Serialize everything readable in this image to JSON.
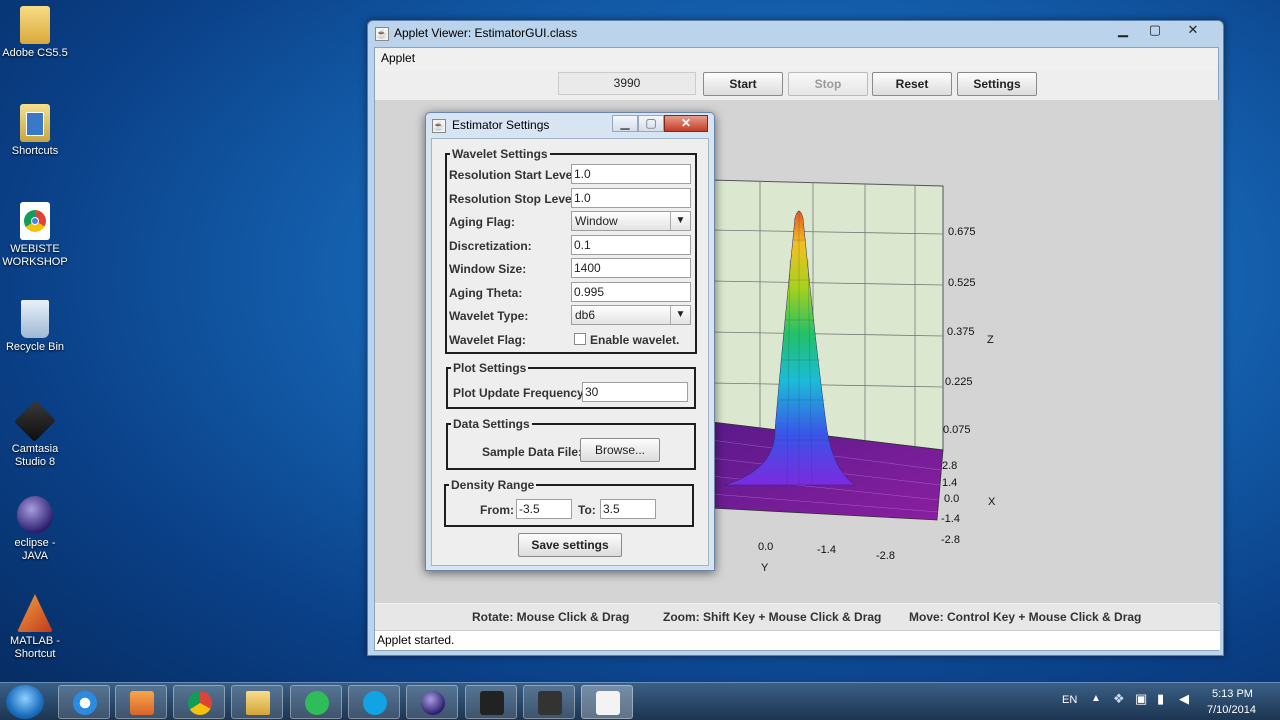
{
  "desktop": {
    "icons": [
      {
        "label": "Adobe CS5.5"
      },
      {
        "label": "Shortcuts"
      },
      {
        "label": "WEBISTE WORKSHOP"
      },
      {
        "label": "Recycle Bin"
      },
      {
        "label": "Camtasia Studio 8"
      },
      {
        "label": "eclipse - JAVA"
      },
      {
        "label": "MATLAB - Shortcut"
      }
    ]
  },
  "applet": {
    "title": "Applet Viewer: EstimatorGUI.class",
    "window_controls": {
      "minimize": "▁",
      "maximize": "▢",
      "close": "✕"
    },
    "menu": "Applet",
    "counter": "3990",
    "buttons": {
      "start": "Start",
      "stop": "Stop",
      "reset": "Reset",
      "settings": "Settings"
    },
    "stop_enabled": false,
    "plot": {
      "z_ticks": [
        "0.675",
        "0.525",
        "0.375",
        "0.225",
        "0.075"
      ],
      "x_ticks": [
        "2.8",
        "1.4",
        "0.0",
        "-1.4",
        "-2.8"
      ],
      "y_ticks": [
        "0.0",
        "-1.4",
        "-2.8"
      ],
      "z_label": "Z",
      "x_label": "X",
      "y_label": "Y"
    },
    "help": {
      "rotate": "Rotate: Mouse Click & Drag",
      "zoom": "Zoom: Shift Key + Mouse Click & Drag",
      "move": "Move: Control Key + Mouse Click & Drag"
    },
    "status": "Applet started."
  },
  "settings": {
    "title": "Estimator Settings",
    "wavelet": {
      "legend": "Wavelet Settings",
      "res_start_label": "Resolution Start Level:",
      "res_start": "1.0",
      "res_stop_label": "Resolution Stop Level:",
      "res_stop": "1.0",
      "aging_flag_label": "Aging Flag:",
      "aging_flag": "Window",
      "discretization_label": "Discretization:",
      "discretization": "0.1",
      "window_size_label": "Window Size:",
      "window_size": "1400",
      "aging_theta_label": "Aging Theta:",
      "aging_theta": "0.995",
      "wavelet_type_label": "Wavelet Type:",
      "wavelet_type": "db6",
      "wavelet_flag_label": "Wavelet Flag:",
      "enable_wavelet_label": "Enable wavelet.",
      "enable_wavelet_checked": false
    },
    "plot": {
      "legend": "Plot Settings",
      "update_freq_label": "Plot Update Frequency:",
      "update_freq": "30"
    },
    "data": {
      "legend": "Data Settings",
      "sample_file_label": "Sample Data File:",
      "browse": "Browse..."
    },
    "density": {
      "legend": "Density Range",
      "from_label": "From:",
      "from": "-3.5",
      "to_label": "To:",
      "to": "3.5"
    },
    "save": "Save settings"
  },
  "taskbar": {
    "lang": "EN",
    "time": "5:13 PM",
    "date": "7/10/2014"
  }
}
